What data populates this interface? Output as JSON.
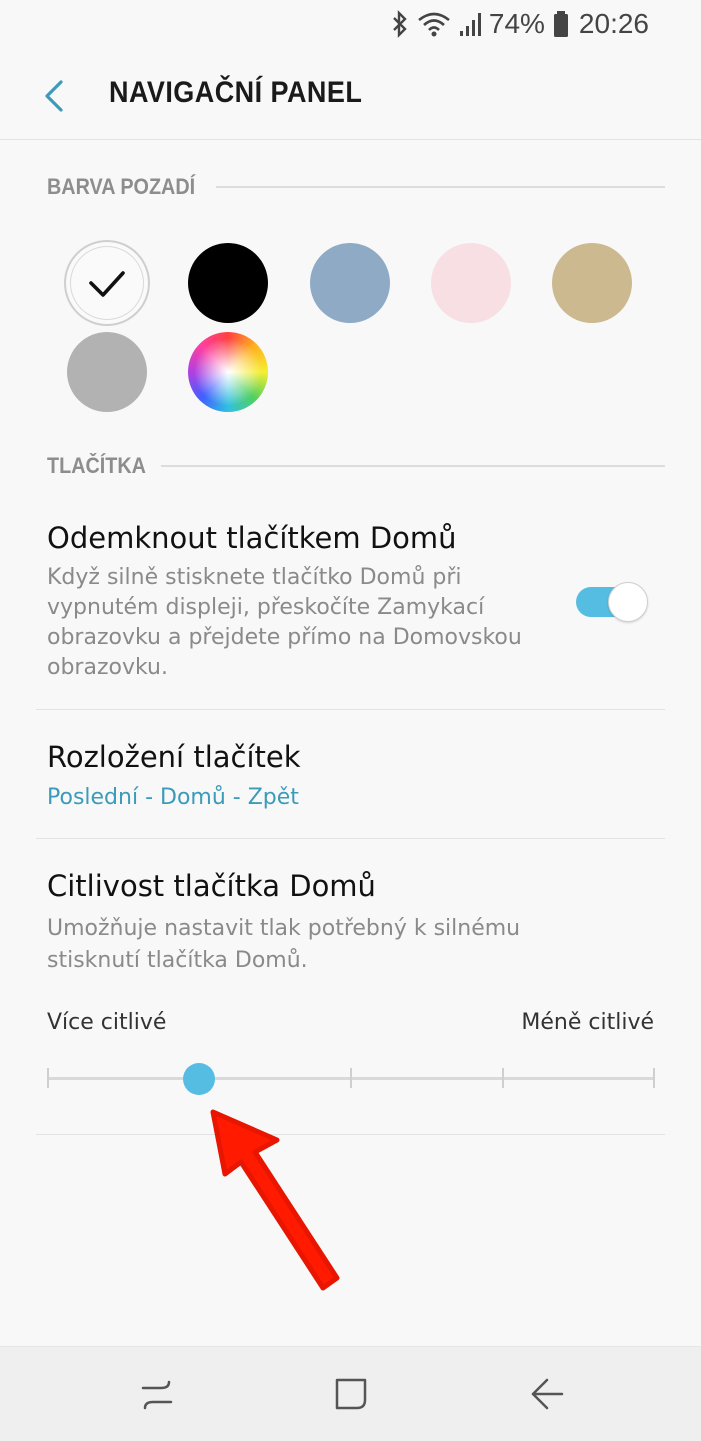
{
  "status_bar": {
    "icons": [
      "bluetooth-icon",
      "wifi-icon",
      "signal-icon",
      "battery-icon"
    ],
    "battery": "74%",
    "time": "20:26"
  },
  "header": {
    "title": "NAVIGAČNÍ PANEL",
    "back_icon": "back-arrow-icon"
  },
  "background_color": {
    "section_title": "BARVA POZADÍ",
    "swatches": [
      {
        "name": "white",
        "color": "#fafafa",
        "selected": true
      },
      {
        "name": "black",
        "color": "#000000",
        "selected": false
      },
      {
        "name": "blue",
        "color": "#8eaac4",
        "selected": false
      },
      {
        "name": "pink",
        "color": "#f7dfe4",
        "selected": false
      },
      {
        "name": "gold",
        "color": "#ccb990",
        "selected": false
      },
      {
        "name": "gray",
        "color": "#b2b2b2",
        "selected": false
      },
      {
        "name": "custom",
        "color": "color-wheel",
        "selected": false
      }
    ]
  },
  "buttons": {
    "section_title": "TLAČÍTKA",
    "unlock": {
      "title": "Odemknout tlačítkem Domů",
      "desc_lines": [
        "Když silně stisknete tlačítko Domů při",
        "vypnutém displeji, přeskočíte Zamykací",
        "obrazovku a přejdete přímo na Domovskou",
        "obrazovku."
      ],
      "toggle_on": true
    },
    "layout": {
      "title": "Rozložení tlačítek",
      "value": "Poslední - Domů - Zpět"
    },
    "sensitivity": {
      "title": "Citlivost tlačítka Domů",
      "desc_lines": [
        "Umožňuje nastavit tlak potřebný k silnému",
        "stisknutí tlačítka Domů."
      ],
      "label_left": "Více citlivé",
      "label_right": "Méně citlivé",
      "steps": 5,
      "value_index": 1
    }
  },
  "colors": {
    "accent": "#56bde2",
    "link": "#3c9bb9",
    "annotation": "#ff1a00"
  },
  "nav_bar": {
    "buttons": [
      "recents-icon",
      "home-icon",
      "back-icon"
    ]
  }
}
